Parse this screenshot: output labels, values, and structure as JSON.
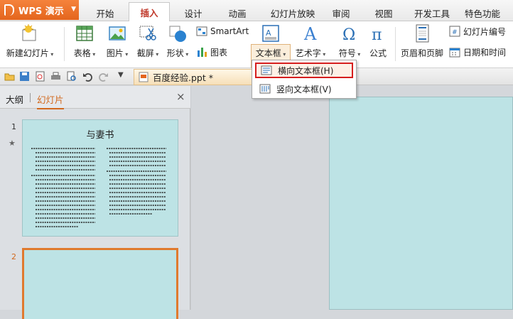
{
  "app": {
    "name": "WPS 演示"
  },
  "tabs": [
    "开始",
    "插入",
    "设计",
    "动画",
    "幻灯片放映",
    "审阅",
    "视图",
    "开发工具",
    "特色功能"
  ],
  "ribbon": {
    "new_slide": "新建幻灯片",
    "table": "表格",
    "image": "图片",
    "screenshot": "截屏",
    "shape": "形状",
    "smartart": "SmartArt",
    "chart": "图表",
    "textbox": "文本框",
    "wordart": "艺术字",
    "symbol": "符号",
    "formula": "公式",
    "header_footer": "页眉和页脚",
    "slide_number": "幻灯片编号",
    "datetime": "日期和时间"
  },
  "document": {
    "tab_label": "百度经验.ppt *"
  },
  "textbox_menu": {
    "horizontal": "横向文本框(H)",
    "vertical": "竖向文本框(V)"
  },
  "panel": {
    "tab_outline": "大纲",
    "tab_slides": "幻灯片",
    "slides": [
      {
        "number": "1",
        "title": "与妻书"
      },
      {
        "number": "2"
      }
    ]
  },
  "colors": {
    "accent": "#e4651d",
    "highlight_border": "#d61e1e",
    "slide_bg": "#bde3e5"
  }
}
